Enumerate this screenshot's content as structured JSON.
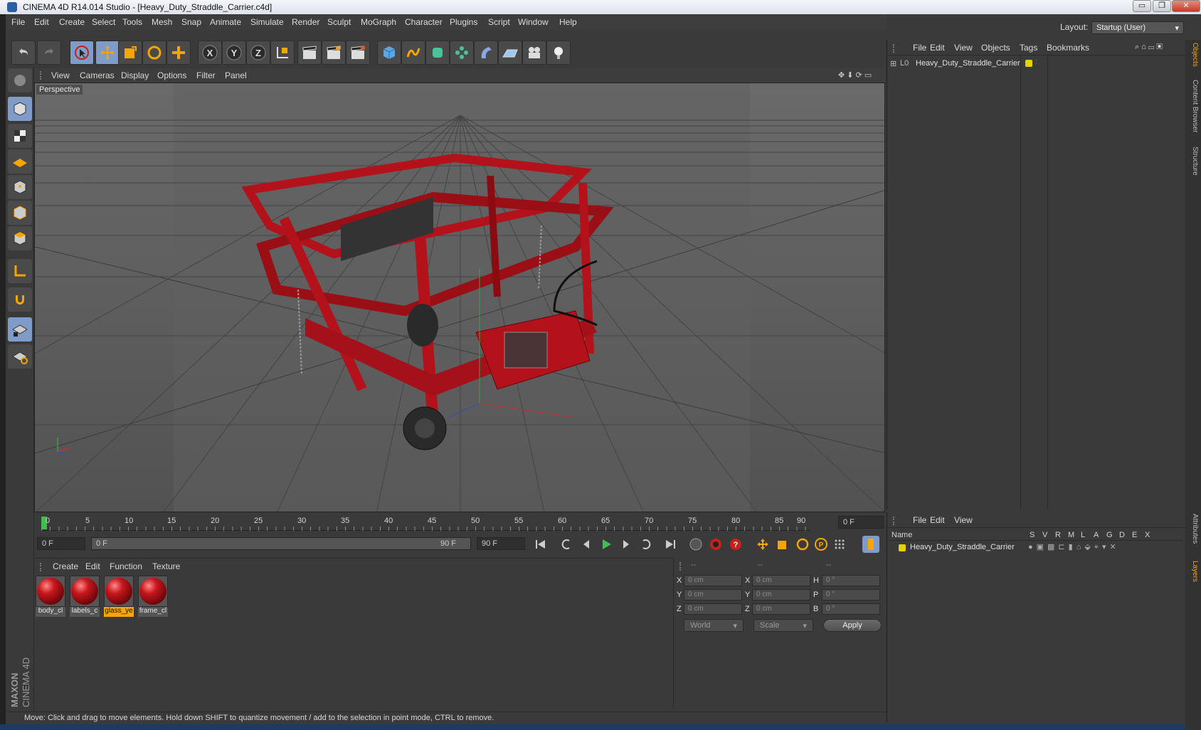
{
  "window": {
    "title": "CINEMA 4D R14.014 Studio - [Heavy_Duty_Straddle_Carrier.c4d]",
    "minimize": "▭",
    "restore": "❐",
    "close": "✕"
  },
  "menubar": {
    "items": [
      "File",
      "Edit",
      "Create",
      "Select",
      "Tools",
      "Mesh",
      "Snap",
      "Animate",
      "Simulate",
      "Render",
      "Sculpt",
      "MoGraph",
      "Character",
      "Plugins",
      "Script",
      "Window",
      "Help"
    ],
    "layout_label": "Layout:",
    "layout_value": "Startup (User)"
  },
  "viewport": {
    "menu": [
      "View",
      "Cameras",
      "Display",
      "Options",
      "Filter",
      "Panel"
    ],
    "label": "Perspective",
    "model_color": "#b3121a"
  },
  "timeline": {
    "ticks": [
      "0",
      "5",
      "10",
      "15",
      "20",
      "25",
      "30",
      "35",
      "40",
      "45",
      "50",
      "55",
      "60",
      "65",
      "70",
      "75",
      "80",
      "85",
      "90"
    ],
    "current_frame_field": "0 F",
    "start_field": "0 F",
    "range_start": "0 F",
    "range_end": "90 F",
    "end_field": "90 F"
  },
  "materials": {
    "menu": [
      "Create",
      "Edit",
      "Function",
      "Texture"
    ],
    "items": [
      {
        "label": "body_cl",
        "selected": false
      },
      {
        "label": "labels_c",
        "selected": false
      },
      {
        "label": "glass_ye",
        "selected": true
      },
      {
        "label": "frame_cl",
        "selected": false
      }
    ]
  },
  "coordinates": {
    "headers": [
      "--",
      "--",
      "--"
    ],
    "rows": [
      {
        "a": "X",
        "av": "0 cm",
        "b": "X",
        "bv": "0 cm",
        "c": "H",
        "cv": "0 °"
      },
      {
        "a": "Y",
        "av": "0 cm",
        "b": "Y",
        "bv": "0 cm",
        "c": "P",
        "cv": "0 °"
      },
      {
        "a": "Z",
        "av": "0 cm",
        "b": "Z",
        "bv": "0 cm",
        "c": "B",
        "cv": "0 °"
      }
    ],
    "mode": "World",
    "transform": "Scale",
    "apply": "Apply"
  },
  "objects_panel": {
    "menu": [
      "File",
      "Edit",
      "View",
      "Objects",
      "Tags",
      "Bookmarks"
    ],
    "object_name": "Heavy_Duty_Straddle_Carrier"
  },
  "layers_panel": {
    "menu": [
      "File",
      "Edit",
      "View"
    ],
    "name_header": "Name",
    "flags": [
      "S",
      "V",
      "R",
      "M",
      "L",
      "A",
      "G",
      "D",
      "E",
      "X"
    ],
    "layer_name": "Heavy_Duty_Straddle_Carrier"
  },
  "side_tabs": {
    "objects": "Objects",
    "content_browser": "Content Browser",
    "structure": "Structure",
    "attributes": "Attributes",
    "layers": "Layers"
  },
  "brand": {
    "maxon": "MAXON",
    "product": "CINEMA 4D"
  },
  "status": "Move: Click and drag to move elements. Hold down SHIFT to quantize movement / add to the selection in point mode, CTRL to remove.",
  "colors": {
    "accent_blue": "#7f9bc8",
    "selection_orange": "#f7a500",
    "model_red": "#b3121a"
  }
}
